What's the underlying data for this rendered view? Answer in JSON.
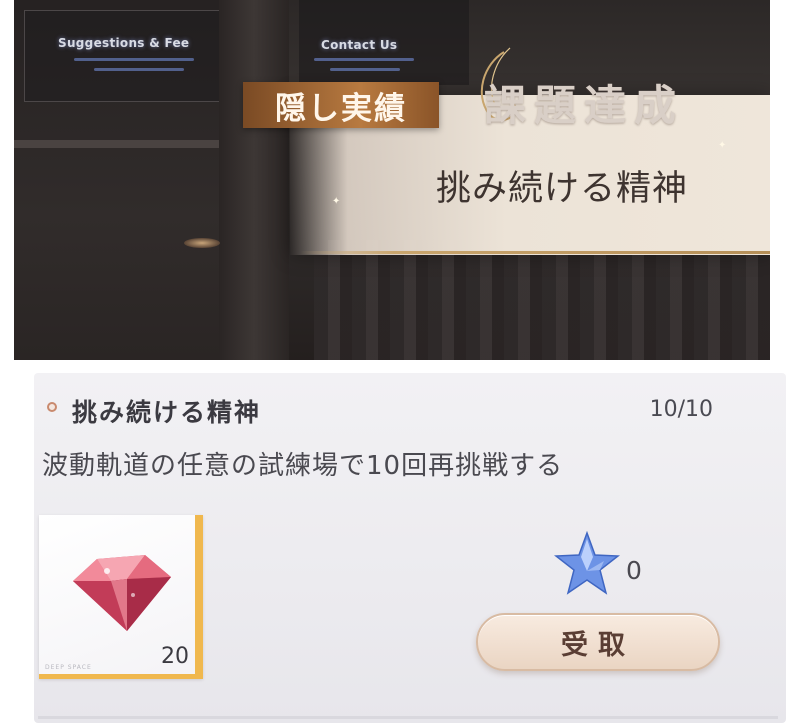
{
  "scene": {
    "signs": {
      "left": "Suggestions & Fee",
      "right": "Contact Us"
    },
    "badge": "隠し実績",
    "achieved_text": "課題達成",
    "banner_title": "挑み続ける精神"
  },
  "task": {
    "title": "挑み続ける精神",
    "progress": "10/10",
    "description": "波動軌道の任意の試練場で10回再挑戦する",
    "reward_item": {
      "icon": "red-diamond-gem-icon",
      "quantity": "20",
      "brand": "DEEP SPACE"
    },
    "star_reward": {
      "icon": "blue-star-icon",
      "count": "0"
    },
    "claim_button": "受取"
  },
  "colors": {
    "accent_gold": "#f0b84e",
    "badge_brown": "#b87a40",
    "button_bg": "#f3e3d5",
    "star_blue": "#4b78d6"
  }
}
